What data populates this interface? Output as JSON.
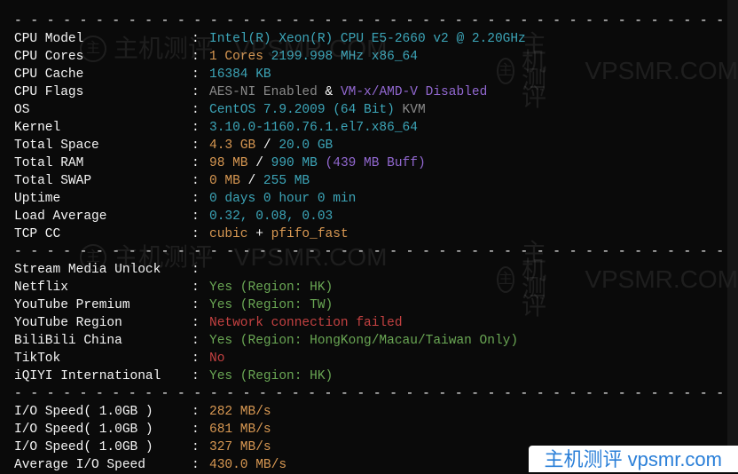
{
  "separator": "- - - - - - - - - - - - - - - - - - - - - - - - - - - - - - - - - - - - - - - - - - - - - - - - - - - - -",
  "sys": {
    "cpu_model": {
      "label": "CPU Model",
      "value": "Intel(R) Xeon(R) CPU E5-2660 v2 @ 2.20GHz"
    },
    "cpu_cores": {
      "label": "CPU Cores",
      "count": "1 Cores",
      "freq": "2199.998 MHz",
      "arch": "x86_64"
    },
    "cpu_cache": {
      "label": "CPU Cache",
      "value": "16384 KB"
    },
    "cpu_flags": {
      "label": "CPU Flags",
      "aes": "AES-NI Enabled",
      "amp": " & ",
      "vtx": "VM-x/AMD-V Disabled"
    },
    "os": {
      "label": "OS",
      "name": "CentOS 7.9.2009 (64 Bit)",
      "virt": " KVM"
    },
    "kernel": {
      "label": "Kernel",
      "value": "3.10.0-1160.76.1.el7.x86_64"
    },
    "total_space": {
      "label": "Total Space",
      "used": "4.3 GB",
      "slash": " / ",
      "total": "20.0 GB"
    },
    "total_ram": {
      "label": "Total RAM",
      "used": "98 MB",
      "slash": " / ",
      "total": "990 MB",
      "buff": " (439 MB Buff)"
    },
    "total_swap": {
      "label": "Total SWAP",
      "used": "0 MB",
      "slash": " / ",
      "total": "255 MB"
    },
    "uptime": {
      "label": "Uptime",
      "value": "0 days 0 hour 0 min"
    },
    "load": {
      "label": "Load Average",
      "value": "0.32, 0.08, 0.03"
    },
    "tcp": {
      "label": "TCP CC",
      "cc": "cubic",
      "plus": " + ",
      "qdisc": "pfifo_fast"
    }
  },
  "stream_header": {
    "label": "Stream Media Unlock"
  },
  "stream": {
    "netflix": {
      "label": "Netflix",
      "value": "Yes (Region: HK)"
    },
    "youtube_premium": {
      "label": "YouTube Premium",
      "value": "Yes (Region: TW)"
    },
    "youtube_region": {
      "label": "YouTube Region",
      "value": "Network connection failed"
    },
    "bilibili": {
      "label": "BiliBili China",
      "value": "Yes (Region: HongKong/Macau/Taiwan Only)"
    },
    "tiktok": {
      "label": "TikTok",
      "value": "No"
    },
    "iqiyi": {
      "label": "iQIYI International",
      "value": "Yes (Region: HK)"
    }
  },
  "io": {
    "r1": {
      "label": "I/O Speed( 1.0GB )",
      "value": "282 MB/s"
    },
    "r2": {
      "label": "I/O Speed( 1.0GB )",
      "value": "681 MB/s"
    },
    "r3": {
      "label": "I/O Speed( 1.0GB )",
      "value": "327 MB/s"
    },
    "avg": {
      "label": "Average I/O Speed",
      "value": "430.0 MB/s"
    }
  },
  "watermark": {
    "logo": "主",
    "text": "主机测评",
    "domain": "VPSMR.COM"
  },
  "badge": {
    "text": "主机测评  vpsmr.com"
  }
}
